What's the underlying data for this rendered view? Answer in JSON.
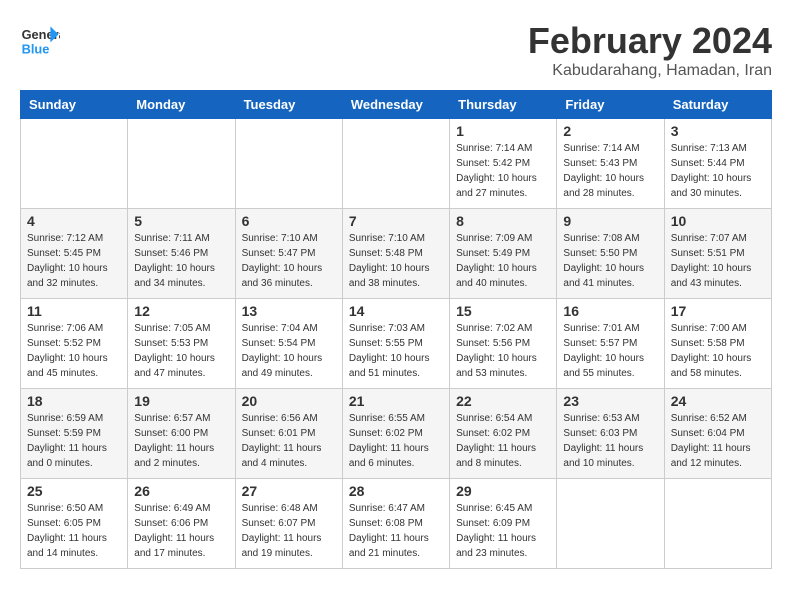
{
  "header": {
    "logo_line1": "General",
    "logo_line2": "Blue",
    "month_year": "February 2024",
    "location": "Kabudarahang, Hamadan, Iran"
  },
  "weekdays": [
    "Sunday",
    "Monday",
    "Tuesday",
    "Wednesday",
    "Thursday",
    "Friday",
    "Saturday"
  ],
  "weeks": [
    [
      {
        "day": "",
        "sunrise": "",
        "sunset": "",
        "daylight": ""
      },
      {
        "day": "",
        "sunrise": "",
        "sunset": "",
        "daylight": ""
      },
      {
        "day": "",
        "sunrise": "",
        "sunset": "",
        "daylight": ""
      },
      {
        "day": "",
        "sunrise": "",
        "sunset": "",
        "daylight": ""
      },
      {
        "day": "1",
        "sunrise": "Sunrise: 7:14 AM",
        "sunset": "Sunset: 5:42 PM",
        "daylight": "Daylight: 10 hours and 27 minutes."
      },
      {
        "day": "2",
        "sunrise": "Sunrise: 7:14 AM",
        "sunset": "Sunset: 5:43 PM",
        "daylight": "Daylight: 10 hours and 28 minutes."
      },
      {
        "day": "3",
        "sunrise": "Sunrise: 7:13 AM",
        "sunset": "Sunset: 5:44 PM",
        "daylight": "Daylight: 10 hours and 30 minutes."
      }
    ],
    [
      {
        "day": "4",
        "sunrise": "Sunrise: 7:12 AM",
        "sunset": "Sunset: 5:45 PM",
        "daylight": "Daylight: 10 hours and 32 minutes."
      },
      {
        "day": "5",
        "sunrise": "Sunrise: 7:11 AM",
        "sunset": "Sunset: 5:46 PM",
        "daylight": "Daylight: 10 hours and 34 minutes."
      },
      {
        "day": "6",
        "sunrise": "Sunrise: 7:10 AM",
        "sunset": "Sunset: 5:47 PM",
        "daylight": "Daylight: 10 hours and 36 minutes."
      },
      {
        "day": "7",
        "sunrise": "Sunrise: 7:10 AM",
        "sunset": "Sunset: 5:48 PM",
        "daylight": "Daylight: 10 hours and 38 minutes."
      },
      {
        "day": "8",
        "sunrise": "Sunrise: 7:09 AM",
        "sunset": "Sunset: 5:49 PM",
        "daylight": "Daylight: 10 hours and 40 minutes."
      },
      {
        "day": "9",
        "sunrise": "Sunrise: 7:08 AM",
        "sunset": "Sunset: 5:50 PM",
        "daylight": "Daylight: 10 hours and 41 minutes."
      },
      {
        "day": "10",
        "sunrise": "Sunrise: 7:07 AM",
        "sunset": "Sunset: 5:51 PM",
        "daylight": "Daylight: 10 hours and 43 minutes."
      }
    ],
    [
      {
        "day": "11",
        "sunrise": "Sunrise: 7:06 AM",
        "sunset": "Sunset: 5:52 PM",
        "daylight": "Daylight: 10 hours and 45 minutes."
      },
      {
        "day": "12",
        "sunrise": "Sunrise: 7:05 AM",
        "sunset": "Sunset: 5:53 PM",
        "daylight": "Daylight: 10 hours and 47 minutes."
      },
      {
        "day": "13",
        "sunrise": "Sunrise: 7:04 AM",
        "sunset": "Sunset: 5:54 PM",
        "daylight": "Daylight: 10 hours and 49 minutes."
      },
      {
        "day": "14",
        "sunrise": "Sunrise: 7:03 AM",
        "sunset": "Sunset: 5:55 PM",
        "daylight": "Daylight: 10 hours and 51 minutes."
      },
      {
        "day": "15",
        "sunrise": "Sunrise: 7:02 AM",
        "sunset": "Sunset: 5:56 PM",
        "daylight": "Daylight: 10 hours and 53 minutes."
      },
      {
        "day": "16",
        "sunrise": "Sunrise: 7:01 AM",
        "sunset": "Sunset: 5:57 PM",
        "daylight": "Daylight: 10 hours and 55 minutes."
      },
      {
        "day": "17",
        "sunrise": "Sunrise: 7:00 AM",
        "sunset": "Sunset: 5:58 PM",
        "daylight": "Daylight: 10 hours and 58 minutes."
      }
    ],
    [
      {
        "day": "18",
        "sunrise": "Sunrise: 6:59 AM",
        "sunset": "Sunset: 5:59 PM",
        "daylight": "Daylight: 11 hours and 0 minutes."
      },
      {
        "day": "19",
        "sunrise": "Sunrise: 6:57 AM",
        "sunset": "Sunset: 6:00 PM",
        "daylight": "Daylight: 11 hours and 2 minutes."
      },
      {
        "day": "20",
        "sunrise": "Sunrise: 6:56 AM",
        "sunset": "Sunset: 6:01 PM",
        "daylight": "Daylight: 11 hours and 4 minutes."
      },
      {
        "day": "21",
        "sunrise": "Sunrise: 6:55 AM",
        "sunset": "Sunset: 6:02 PM",
        "daylight": "Daylight: 11 hours and 6 minutes."
      },
      {
        "day": "22",
        "sunrise": "Sunrise: 6:54 AM",
        "sunset": "Sunset: 6:02 PM",
        "daylight": "Daylight: 11 hours and 8 minutes."
      },
      {
        "day": "23",
        "sunrise": "Sunrise: 6:53 AM",
        "sunset": "Sunset: 6:03 PM",
        "daylight": "Daylight: 11 hours and 10 minutes."
      },
      {
        "day": "24",
        "sunrise": "Sunrise: 6:52 AM",
        "sunset": "Sunset: 6:04 PM",
        "daylight": "Daylight: 11 hours and 12 minutes."
      }
    ],
    [
      {
        "day": "25",
        "sunrise": "Sunrise: 6:50 AM",
        "sunset": "Sunset: 6:05 PM",
        "daylight": "Daylight: 11 hours and 14 minutes."
      },
      {
        "day": "26",
        "sunrise": "Sunrise: 6:49 AM",
        "sunset": "Sunset: 6:06 PM",
        "daylight": "Daylight: 11 hours and 17 minutes."
      },
      {
        "day": "27",
        "sunrise": "Sunrise: 6:48 AM",
        "sunset": "Sunset: 6:07 PM",
        "daylight": "Daylight: 11 hours and 19 minutes."
      },
      {
        "day": "28",
        "sunrise": "Sunrise: 6:47 AM",
        "sunset": "Sunset: 6:08 PM",
        "daylight": "Daylight: 11 hours and 21 minutes."
      },
      {
        "day": "29",
        "sunrise": "Sunrise: 6:45 AM",
        "sunset": "Sunset: 6:09 PM",
        "daylight": "Daylight: 11 hours and 23 minutes."
      },
      {
        "day": "",
        "sunrise": "",
        "sunset": "",
        "daylight": ""
      },
      {
        "day": "",
        "sunrise": "",
        "sunset": "",
        "daylight": ""
      }
    ]
  ]
}
